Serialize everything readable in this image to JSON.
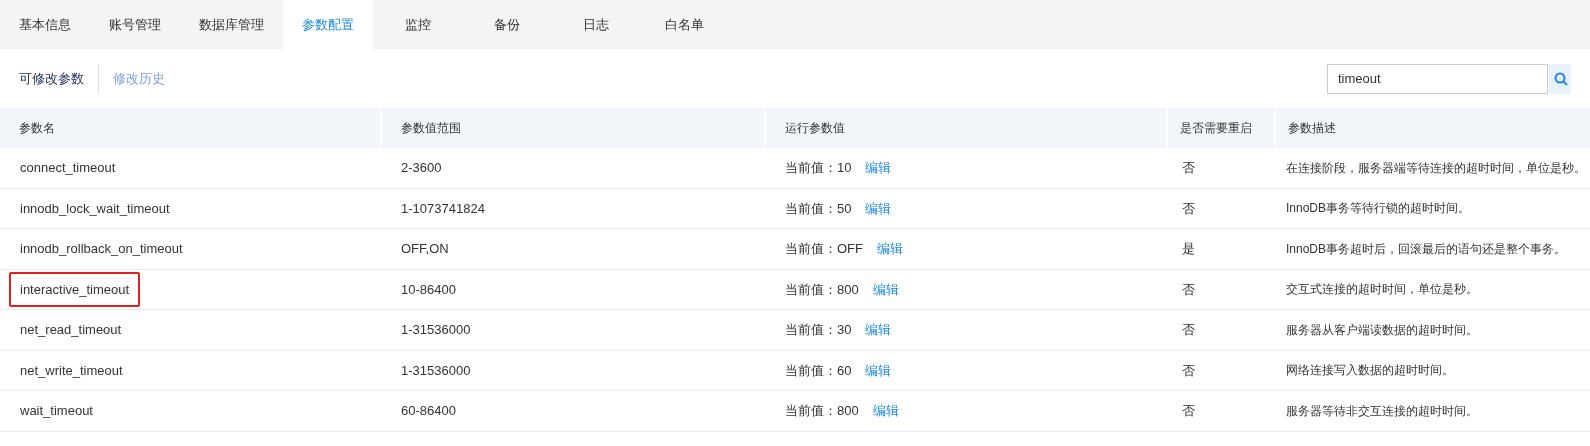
{
  "tabs": [
    {
      "label": "基本信息",
      "selected": false
    },
    {
      "label": "账号管理",
      "selected": false
    },
    {
      "label": "数据库管理",
      "selected": false
    },
    {
      "label": "参数配置",
      "selected": true
    },
    {
      "label": "监控",
      "selected": false
    },
    {
      "label": "备份",
      "selected": false
    },
    {
      "label": "日志",
      "selected": false
    },
    {
      "label": "白名单",
      "selected": false
    }
  ],
  "subtabs": [
    {
      "label": "可修改参数",
      "selected": true
    },
    {
      "label": "修改历史",
      "selected": false
    }
  ],
  "search": {
    "value": "timeout"
  },
  "table": {
    "columns": [
      "参数名",
      "参数值范围",
      "运行参数值",
      "是否需要重启",
      "参数描述"
    ],
    "rows": [
      {
        "name": "connect_timeout",
        "range": "2-3600",
        "current": "当前值：10",
        "edit": "编辑",
        "restart": "否",
        "description": "在连接阶段，服务器端等待连接的超时时间，单位是秒。",
        "highlighted": false
      },
      {
        "name": "innodb_lock_wait_timeout",
        "range": "1-1073741824",
        "current": "当前值：50",
        "edit": "编辑",
        "restart": "否",
        "description": "InnoDB事务等待行锁的超时时间。",
        "highlighted": false
      },
      {
        "name": "innodb_rollback_on_timeout",
        "range": "OFF,ON",
        "current": "当前值：OFF",
        "edit": "编辑",
        "restart": "是",
        "description": "InnoDB事务超时后，回滚最后的语句还是整个事务。",
        "highlighted": false
      },
      {
        "name": "interactive_timeout",
        "range": "10-86400",
        "current": "当前值：800",
        "edit": "编辑",
        "restart": "否",
        "description": "交互式连接的超时时间，单位是秒。",
        "highlighted": true
      },
      {
        "name": "net_read_timeout",
        "range": "1-31536000",
        "current": "当前值：30",
        "edit": "编辑",
        "restart": "否",
        "description": "服务器从客户端读数据的超时时间。",
        "highlighted": false
      },
      {
        "name": "net_write_timeout",
        "range": "1-31536000",
        "current": "当前值：60",
        "edit": "编辑",
        "restart": "否",
        "description": "网络连接写入数据的超时时间。",
        "highlighted": false
      },
      {
        "name": "wait_timeout",
        "range": "60-86400",
        "current": "当前值：800",
        "edit": "编辑",
        "restart": "否",
        "description": "服务器等待非交互连接的超时时间。",
        "highlighted": false
      }
    ]
  }
}
